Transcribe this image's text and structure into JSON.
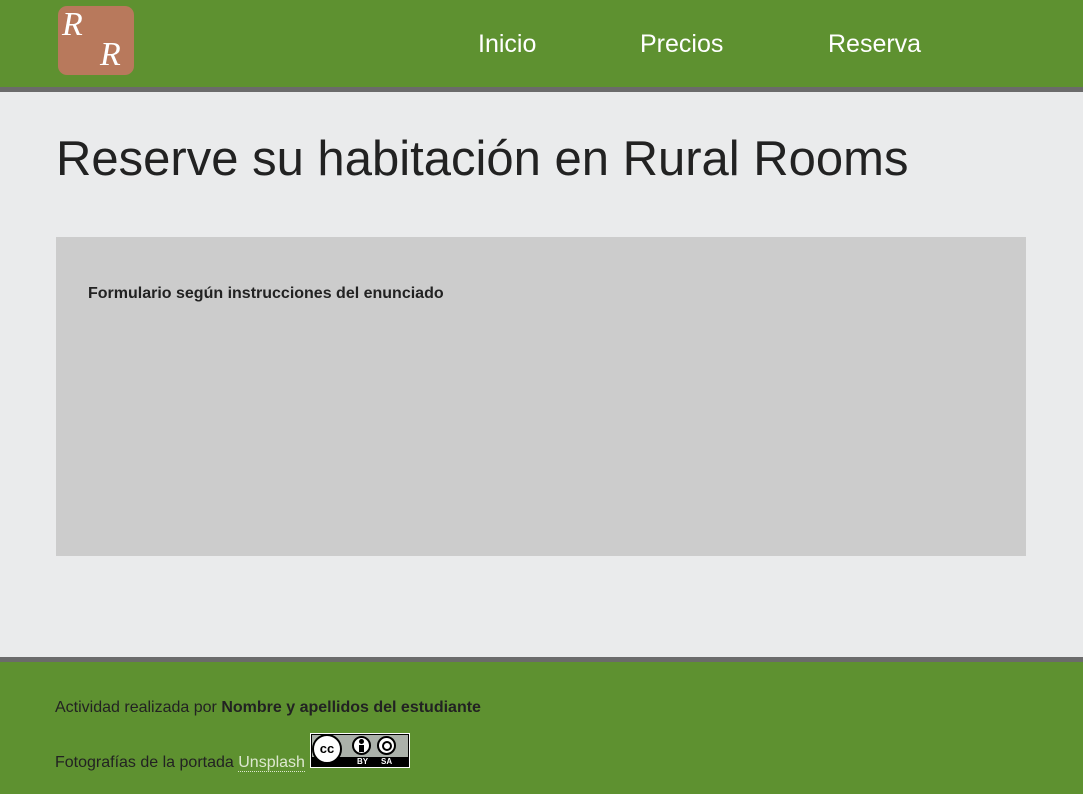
{
  "header": {
    "logo": {
      "letters": [
        "R",
        "R"
      ],
      "background_color": "#b8795c"
    },
    "nav": [
      {
        "label": "Inicio"
      },
      {
        "label": "Precios"
      },
      {
        "label": "Reserva"
      }
    ],
    "background_color": "#5e9130"
  },
  "main": {
    "title": "Reserve su habitación en Rural Rooms",
    "form_box": {
      "note": "Formulario según instrucciones del enunciado",
      "background_color": "#cccccc"
    }
  },
  "footer": {
    "credit_prefix": "Actividad realizada por",
    "credit_name": "Nombre y apellidos del estudiante",
    "photos_prefix": "Fotografías de la portada",
    "photos_link": "Unsplash",
    "license_badge": {
      "icon": "cc-by-sa-icon",
      "cc_text": "cc",
      "by_text": "BY",
      "sa_text": "SA"
    },
    "background_color": "#5e9130"
  }
}
